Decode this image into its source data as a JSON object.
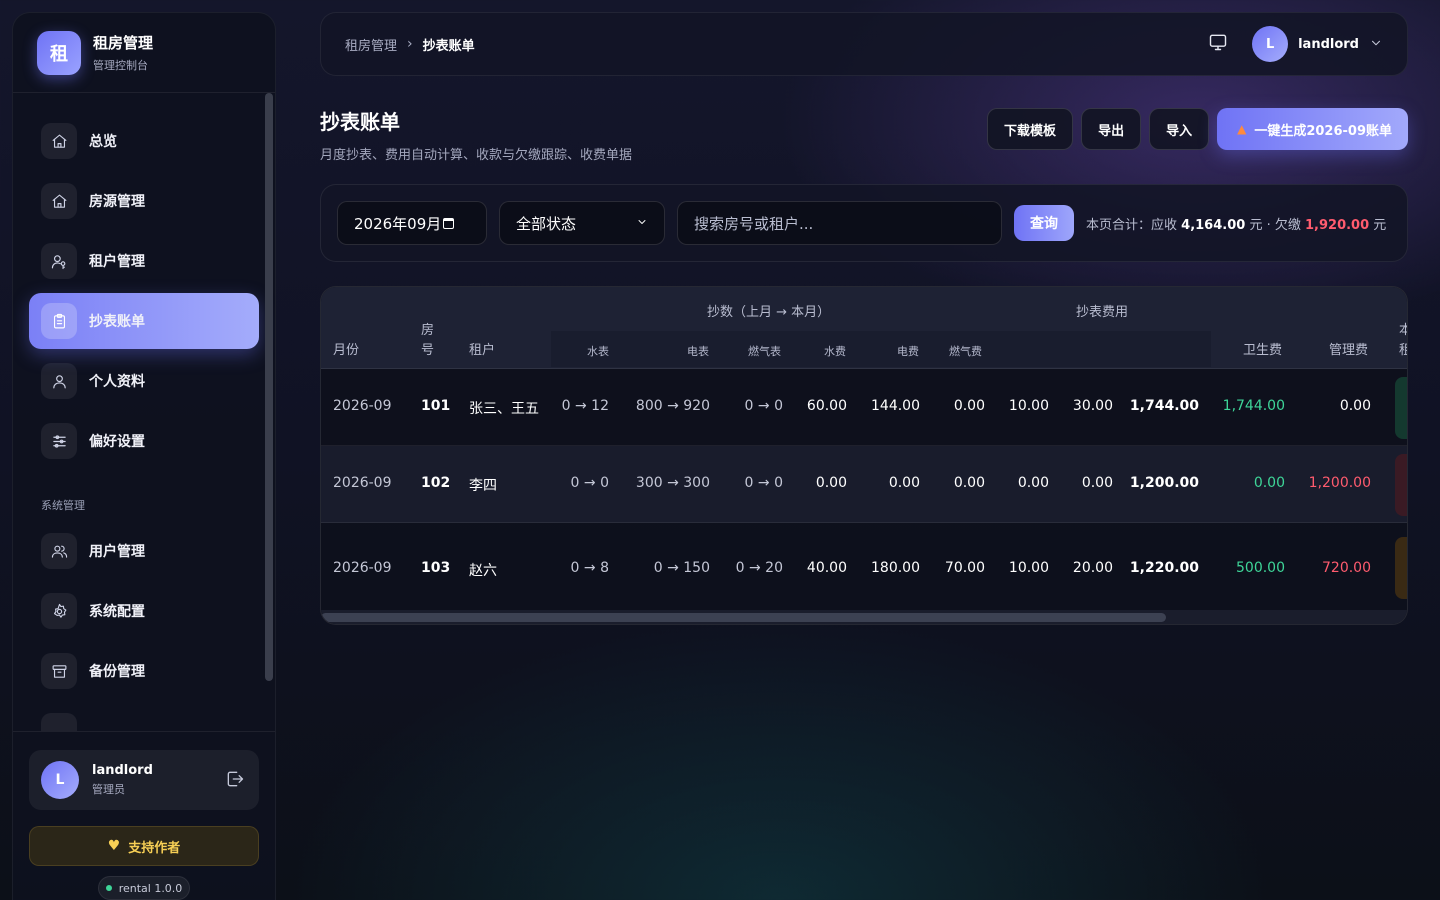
{
  "brand": {
    "logo": "租",
    "title": "租房管理",
    "subtitle": "管理控制台"
  },
  "nav": {
    "items": [
      {
        "label": "总览",
        "icon": "home-icon"
      },
      {
        "label": "房源管理",
        "icon": "home-icon"
      },
      {
        "label": "租户管理",
        "icon": "user-key-icon"
      },
      {
        "label": "抄表账单",
        "icon": "clipboard-icon",
        "active": true
      },
      {
        "label": "个人资料",
        "icon": "user-icon"
      },
      {
        "label": "偏好设置",
        "icon": "sliders-icon"
      }
    ],
    "section_label": "系统管理",
    "system_items": [
      {
        "label": "用户管理",
        "icon": "users-icon"
      },
      {
        "label": "系统配置",
        "icon": "gear-icon"
      },
      {
        "label": "备份管理",
        "icon": "archive-icon"
      }
    ]
  },
  "sidebar_user": {
    "initial": "L",
    "name": "landlord",
    "role": "管理员"
  },
  "support": {
    "label": "支持作者",
    "icon": "heart-icon"
  },
  "version": {
    "label": "rental 1.0.0"
  },
  "topbar": {
    "breadcrumb": [
      "租房管理",
      "抄表账单"
    ],
    "user_initial": "L",
    "username": "landlord"
  },
  "page": {
    "title": "抄表账单",
    "subtitle": "月度抄表、费用自动计算、收款与欠缴跟踪、收费单据",
    "actions": {
      "download_template": "下载模板",
      "export": "导出",
      "import": "导入",
      "generate": "一键生成2026-09账单"
    }
  },
  "filter": {
    "month": "2026年09月",
    "status": "全部状态",
    "search_placeholder": "搜索房号或租户...",
    "query_label": "查询",
    "summary_prefix": "本页合计：应收",
    "receivable": "4,164.00",
    "summary_mid": "元 · 欠缴",
    "arrears": "1,920.00",
    "summary_suffix": "元"
  },
  "table": {
    "headers": {
      "month": "月份",
      "room_line1": "房",
      "room_line2": "号",
      "tenant": "租户",
      "readings_group": "抄数（上月 → 本月）",
      "fees_group": "抄表费用",
      "water_meter": "水表",
      "electric_meter": "电表",
      "gas_meter": "燃气表",
      "water_fee": "水费",
      "electric_fee": "电费",
      "gas_fee": "燃气费",
      "sanitation_fee": "卫生费",
      "management_fee": "管理费",
      "rent_partial_1": "本",
      "rent_partial_2": "租"
    },
    "rows": [
      {
        "month": "2026-09",
        "room": "101",
        "tenant": "张三、王五",
        "water": "0 → 12",
        "electric": "800 → 920",
        "gas": "0 → 0",
        "water_fee": "60.00",
        "electric_fee": "144.00",
        "gas_fee": "0.00",
        "sanitation": "10.00",
        "management": "30.00",
        "total": "1,744.00",
        "paid": "1,744.00",
        "arrears": "0.00",
        "status_color": "#14392f"
      },
      {
        "month": "2026-09",
        "room": "102",
        "tenant": "李四",
        "water": "0 → 0",
        "electric": "300 → 300",
        "gas": "0 → 0",
        "water_fee": "0.00",
        "electric_fee": "0.00",
        "gas_fee": "0.00",
        "sanitation": "0.00",
        "management": "0.00",
        "total": "1,200.00",
        "paid": "0.00",
        "arrears": "1,200.00",
        "status_color": "#3a1a24"
      },
      {
        "month": "2026-09",
        "room": "103",
        "tenant": "赵六",
        "water": "0 → 8",
        "electric": "0 → 150",
        "gas": "0 → 20",
        "water_fee": "40.00",
        "electric_fee": "180.00",
        "gas_fee": "70.00",
        "sanitation": "10.00",
        "management": "20.00",
        "total": "1,220.00",
        "paid": "500.00",
        "arrears": "720.00",
        "status_color": "#3a2a14"
      }
    ]
  }
}
